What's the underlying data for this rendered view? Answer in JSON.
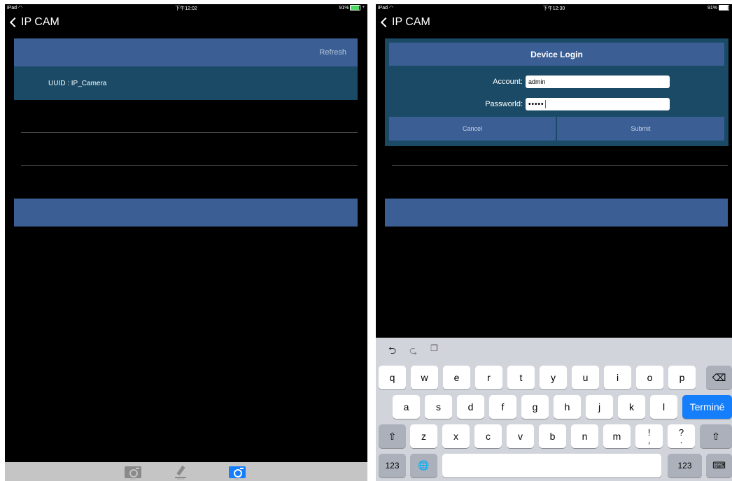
{
  "left": {
    "status": {
      "carrier": "iPad ",
      "time": "下午12:02",
      "battery": "91%",
      "battery_level": 0.91
    },
    "nav": {
      "back_title": "IP CAM"
    },
    "refresh_label": "Refresh",
    "device": {
      "label": "UUID : IP_Camera"
    },
    "tabbar": {
      "tab_snap": "Snap",
      "tab_record": "Record",
      "tab_cam": "Cam"
    }
  },
  "right": {
    "status": {
      "carrier": "iPad ",
      "time": "下午12:30",
      "battery": "91%",
      "battery_level": 0.91
    },
    "nav": {
      "back_title": "IP CAM"
    },
    "dialog": {
      "title": "Device Login",
      "account_label": "Account:",
      "account_value": "admin",
      "password_label": "Passworld:",
      "password_value": "•••••",
      "cancel_label": "Cancel",
      "submit_label": "Submit"
    },
    "keyboard": {
      "row1": [
        "q",
        "w",
        "e",
        "r",
        "t",
        "y",
        "u",
        "i",
        "o",
        "p"
      ],
      "row2": [
        "a",
        "s",
        "d",
        "f",
        "g",
        "h",
        "j",
        "k",
        "l"
      ],
      "row3": [
        "z",
        "x",
        "c",
        "v",
        "b",
        "n",
        "m"
      ],
      "done_label": "Terminé",
      "numbers_label": "123",
      "punct1_top": "!",
      "punct1_bottom": ",",
      "punct2_top": "?",
      "punct2_bottom": "."
    }
  }
}
